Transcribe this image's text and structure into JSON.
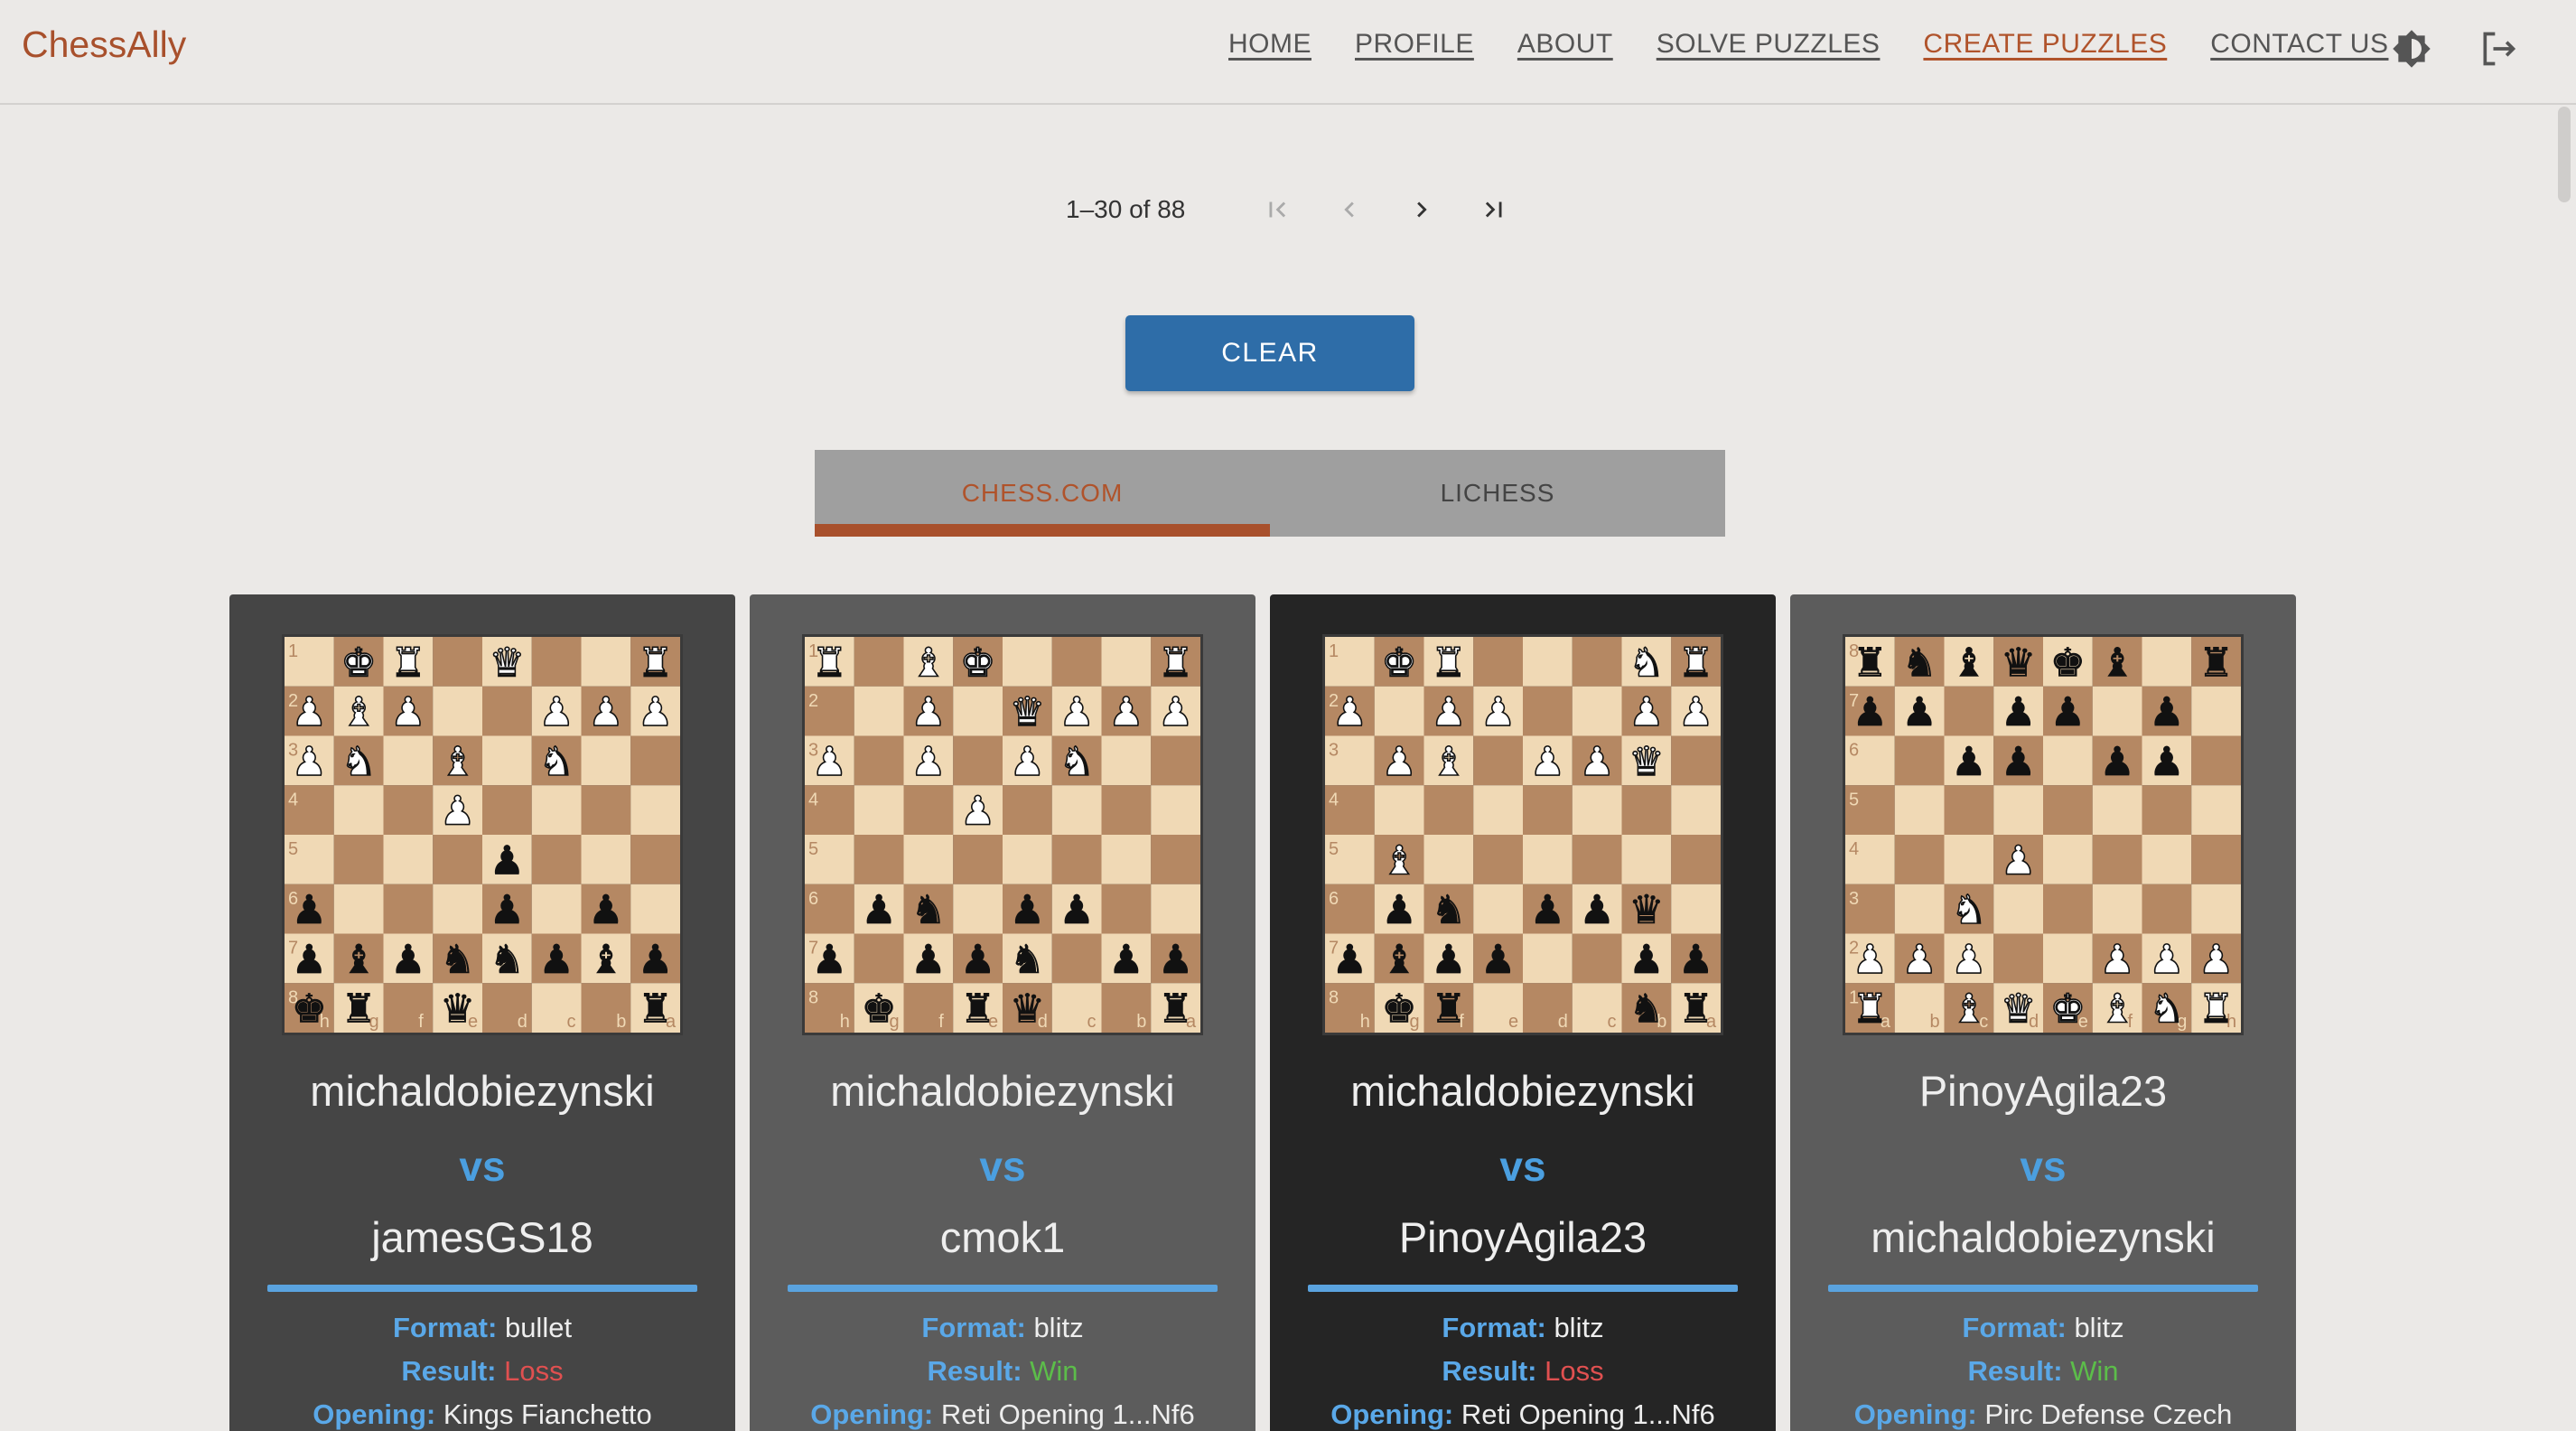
{
  "brand": "ChessAlly",
  "nav": [
    "HOME",
    "PROFILE",
    "ABOUT",
    "SOLVE PUZZLES",
    "CREATE PUZZLES",
    "CONTACT US"
  ],
  "active_nav": "CREATE PUZZLES",
  "icons": {
    "theme": "brightness-icon",
    "logout": "logout-icon"
  },
  "pager": {
    "range": "1–30 of 88"
  },
  "clear_label": "CLEAR",
  "tabs": [
    "CHESS.COM",
    "LICHESS"
  ],
  "active_tab": "CHESS.COM",
  "labels": {
    "vs": "vs",
    "format": "Format:",
    "result": "Result:",
    "opening": "Opening:"
  },
  "colors": {
    "brand": "#a8502c",
    "button": "#2e6da8",
    "accent": "#5aa3df",
    "light_square": "#f0d9b5",
    "dark_square": "#b58863"
  },
  "cards": [
    {
      "player1": "michaldobiezynski",
      "player2": "jamesGS18",
      "format": "bullet",
      "result": "Loss",
      "opening": "Kings Fianchetto",
      "board": [
        "1KR.Q..R",
        "PBP..PPP",
        "PN.B.N..",
        "...P....",
        "....p...",
        "p...p.p.",
        "pbpnnpbp",
        "kr.q...r"
      ],
      "ranks": [
        "1",
        "2",
        "3",
        "4",
        "5",
        "6",
        "7",
        "8"
      ],
      "files": [
        "h",
        "g",
        "f",
        "e",
        "d",
        "c",
        "b",
        "a"
      ]
    },
    {
      "player1": "michaldobiezynski",
      "player2": "cmok1",
      "format": "blitz",
      "result": "Win",
      "opening": "Reti Opening 1...Nf6",
      "board": [
        "R.BK...R",
        "..P.QPPP",
        "P.P.PN..",
        "...P....",
        "........",
        ".pn.pp..",
        "p.ppn.pp",
        ".k.rq..r"
      ],
      "ranks": [
        "1",
        "2",
        "3",
        "4",
        "5",
        "6",
        "7",
        "8"
      ],
      "files": [
        "h",
        "g",
        "f",
        "e",
        "d",
        "c",
        "b",
        "a"
      ]
    },
    {
      "player1": "michaldobiezynski",
      "player2": "PinoyAgila23",
      "format": "blitz",
      "result": "Loss",
      "opening": "Reti Opening 1...Nf6",
      "board": [
        ".KR...NR",
        "P.PP..PP",
        ".PB.PPQ.",
        "........",
        ".B......",
        ".pn.ppq.",
        "pbpp..pp",
        ".kr...nr"
      ],
      "ranks": [
        "1",
        "2",
        "3",
        "4",
        "5",
        "6",
        "7",
        "8"
      ],
      "files": [
        "h",
        "g",
        "f",
        "e",
        "d",
        "c",
        "b",
        "a"
      ]
    },
    {
      "player1": "PinoyAgila23",
      "player2": "michaldobiezynski",
      "format": "blitz",
      "result": "Win",
      "opening": "Pirc Defense Czech",
      "board": [
        "rnbqkb.r",
        "pp.pp.p.",
        "..pp.pp.",
        "........",
        "...P....",
        "..N.....",
        "PPP..PPP",
        "R.BQKBNR"
      ],
      "ranks": [
        "8",
        "7",
        "6",
        "5",
        "4",
        "3",
        "2",
        "1"
      ],
      "files": [
        "a",
        "b",
        "c",
        "d",
        "e",
        "f",
        "g",
        "h"
      ]
    }
  ]
}
